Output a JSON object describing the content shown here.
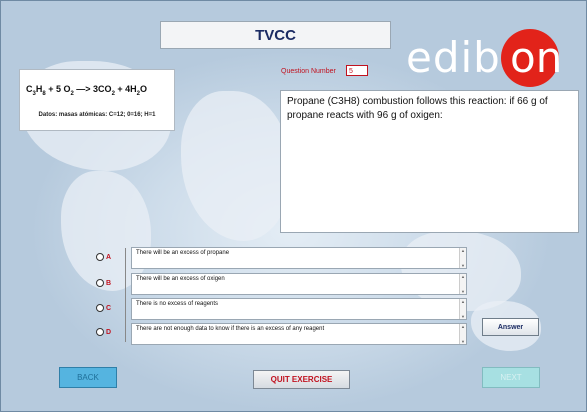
{
  "window": {
    "top_title": ""
  },
  "header": {
    "title": "TVCC"
  },
  "logo": {
    "text_left": "edib",
    "text_right": "on"
  },
  "formula": {
    "equation_parts": [
      "C",
      "3",
      "H",
      "8",
      " + 5 O",
      "2",
      " —> 3CO",
      "2",
      " + 4H",
      "2",
      "O"
    ],
    "atomic_masses": "Datos: masas atómicas: C=12; 0=16; H=1"
  },
  "question": {
    "number_label": "Question Number",
    "number_value": "5",
    "text": "Propane (C3H8) combustion follows this reaction: if 66 g of propane reacts with 96 g of oxigen:"
  },
  "options": [
    {
      "letter": "A",
      "text": "There will be an excess of propane"
    },
    {
      "letter": "B",
      "text": "There will be an excess of oxigen"
    },
    {
      "letter": "C",
      "text": "There is no excess of reagents"
    },
    {
      "letter": "D",
      "text": "There are not enough data to know if there is an excess of any reagent"
    }
  ],
  "buttons": {
    "answer": "Answer",
    "back": "BACK",
    "quit": "QUIT EXERCISE",
    "next": "NEXT"
  },
  "icons": {
    "scroll_up": "arrow-up-icon",
    "scroll_down": "arrow-down-icon"
  },
  "colors": {
    "accent_red": "#c1121f",
    "logo_red": "#e2231a",
    "title_blue": "#1b2b63",
    "back_blue": "#55b4e0"
  }
}
